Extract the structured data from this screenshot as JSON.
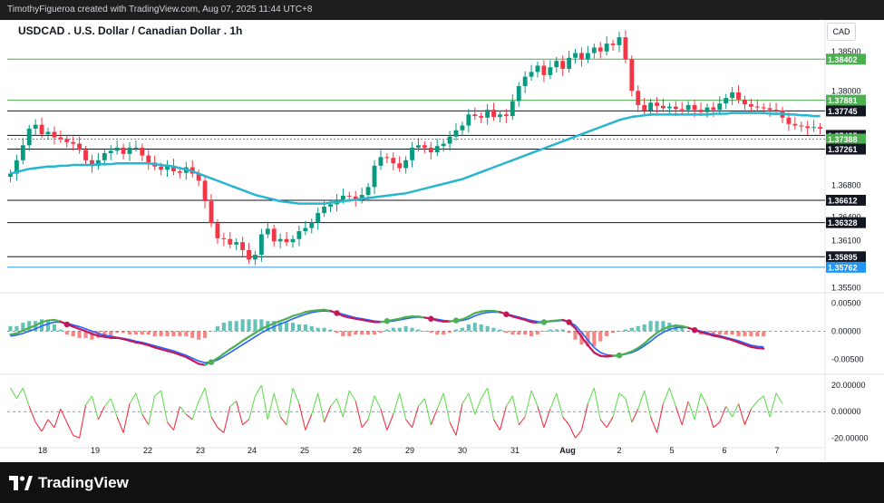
{
  "header": {
    "attribution": "TimothyFigueroa created with TradingView.com, Aug 07, 2025 11:44 UTC+8",
    "title": "USDCAD . U.S. Dollar / Canadian Dollar . 1h",
    "currency": "CAD"
  },
  "footer": {
    "brand": "TradingView"
  },
  "colors": {
    "bull": "#089981",
    "bear": "#f23645",
    "ma": "#27b6d0",
    "macd_fast_up": "#4caf50",
    "macd_fast_down": "#c2185b",
    "macd_slow": "#2962ff",
    "rsi_up": "#66dd55",
    "rsi_down": "#ee3344",
    "level": "#131722",
    "level_green": "#4caf50",
    "level_blue": "#2196f3"
  },
  "chart_data": [
    {
      "type": "candlestick",
      "name": "price",
      "x": [
        "18",
        "19",
        "22",
        "23",
        "24",
        "25",
        "26",
        "29",
        "30",
        "31",
        "Aug",
        "2",
        "5",
        "6",
        "7"
      ],
      "ylim": [
        1.3545,
        1.389
      ],
      "y_ticks": [
        "1.38500",
        "1.38000",
        "1.36800",
        "1.36400",
        "1.36100",
        "1.35500"
      ],
      "ma_name": "",
      "closes": [
        1.3695,
        1.3712,
        1.3731,
        1.3752,
        1.3757,
        1.3745,
        1.3748,
        1.3741,
        1.3739,
        1.3735,
        1.3733,
        1.3725,
        1.3712,
        1.3705,
        1.3712,
        1.3721,
        1.3724,
        1.3728,
        1.372,
        1.3728,
        1.3728,
        1.3718,
        1.3709,
        1.3704,
        1.37,
        1.3705,
        1.3698,
        1.3696,
        1.3703,
        1.3695,
        1.3686,
        1.366,
        1.3632,
        1.3613,
        1.3612,
        1.3605,
        1.3608,
        1.3598,
        1.3586,
        1.3592,
        1.3618,
        1.3625,
        1.3609,
        1.3612,
        1.3608,
        1.3612,
        1.3622,
        1.3626,
        1.3633,
        1.3645,
        1.3653,
        1.3656,
        1.3662,
        1.3667,
        1.3666,
        1.3662,
        1.3668,
        1.3678,
        1.3705,
        1.3716,
        1.3715,
        1.3708,
        1.3702,
        1.3712,
        1.3728,
        1.3731,
        1.3728,
        1.3722,
        1.373,
        1.3733,
        1.3742,
        1.375,
        1.3756,
        1.377,
        1.3768,
        1.3766,
        1.3776,
        1.3767,
        1.377,
        1.3768,
        1.3787,
        1.3806,
        1.3818,
        1.3824,
        1.3832,
        1.382,
        1.383,
        1.3838,
        1.3828,
        1.3842,
        1.3848,
        1.384,
        1.3848,
        1.3855,
        1.385,
        1.386,
        1.3858,
        1.3868,
        1.384,
        1.38,
        1.3782,
        1.3775,
        1.3785,
        1.3781,
        1.3778,
        1.378,
        1.3777,
        1.3776,
        1.3782,
        1.3776,
        1.3773,
        1.3779,
        1.3776,
        1.3784,
        1.3791,
        1.3798,
        1.3789,
        1.3783,
        1.378,
        1.3779,
        1.3778,
        1.3776,
        1.3775,
        1.3766,
        1.3758,
        1.3756,
        1.3755,
        1.3753,
        1.3754,
        1.3752
      ],
      "ma": [
        1.3695,
        1.3697,
        1.3699,
        1.3701,
        1.3702,
        1.3703,
        1.3704,
        1.3704,
        1.3705,
        1.3705,
        1.3706,
        1.3706,
        1.3706,
        1.3706,
        1.3707,
        1.3707,
        1.3707,
        1.3708,
        1.3708,
        1.3708,
        1.3708,
        1.3708,
        1.3708,
        1.3707,
        1.3706,
        1.3705,
        1.3704,
        1.3702,
        1.37,
        1.3698,
        1.3695,
        1.3692,
        1.3689,
        1.3686,
        1.3683,
        1.368,
        1.3677,
        1.3674,
        1.3671,
        1.3668,
        1.3666,
        1.3664,
        1.3662,
        1.366,
        1.3659,
        1.3658,
        1.3657,
        1.3657,
        1.3657,
        1.3657,
        1.3657,
        1.3658,
        1.3659,
        1.366,
        1.3661,
        1.3662,
        1.3663,
        1.3664,
        1.3665,
        1.3666,
        1.3667,
        1.3668,
        1.3669,
        1.367,
        1.3672,
        1.3674,
        1.3676,
        1.3678,
        1.368,
        1.3682,
        1.3684,
        1.3686,
        1.3688,
        1.3691,
        1.3694,
        1.3697,
        1.37,
        1.3703,
        1.3706,
        1.3709,
        1.3712,
        1.3715,
        1.3718,
        1.3721,
        1.3724,
        1.3727,
        1.373,
        1.3733,
        1.3736,
        1.3739,
        1.3742,
        1.3745,
        1.3748,
        1.3751,
        1.3754,
        1.3757,
        1.376,
        1.3763,
        1.3765,
        1.3767,
        1.3768,
        1.3769,
        1.377,
        1.377,
        1.377,
        1.377,
        1.377,
        1.377,
        1.377,
        1.377,
        1.377,
        1.377,
        1.3771,
        1.3771,
        1.3771,
        1.3772,
        1.3772,
        1.3772,
        1.3772,
        1.3772,
        1.3772,
        1.3771,
        1.3771,
        1.3771,
        1.377,
        1.377,
        1.3769,
        1.3769,
        1.3768,
        1.3768
      ],
      "levels": [
        {
          "value": 1.38402,
          "label": "1.38402",
          "style": "green"
        },
        {
          "value": 1.37881,
          "label": "1.37881",
          "style": "green"
        },
        {
          "value": 1.37745,
          "label": "1.37745",
          "style": "dark"
        },
        {
          "value": 1.37435,
          "label": "1.37435",
          "style": "dark"
        },
        {
          "value": 1.37388,
          "label": "1.37388",
          "style": "green"
        },
        {
          "value": 1.37261,
          "label": "1.37261",
          "style": "dark"
        },
        {
          "value": 1.36612,
          "label": "1.36612",
          "style": "dark"
        },
        {
          "value": 1.36328,
          "label": "1.36328",
          "style": "dark"
        },
        {
          "value": 1.35895,
          "label": "1.35895",
          "style": "dark"
        },
        {
          "value": 1.35762,
          "label": "1.35762",
          "style": "blue"
        }
      ]
    },
    {
      "type": "line",
      "name": "macd",
      "ylim": [
        -0.0075,
        0.0065
      ],
      "y_ticks": [
        "0.00500",
        "0.00000",
        "-0.00500"
      ],
      "fast": [
        -0.0006,
        -0.0004,
        0.0001,
        0.0006,
        0.001,
        0.0016,
        0.0019,
        0.002,
        0.0017,
        0.0012,
        0.0008,
        0.0004,
        0.0,
        -0.0005,
        -0.0008,
        -0.001,
        -0.0012,
        -0.0012,
        -0.0014,
        -0.0017,
        -0.002,
        -0.0022,
        -0.0025,
        -0.0029,
        -0.0032,
        -0.0035,
        -0.0038,
        -0.0042,
        -0.0046,
        -0.0052,
        -0.0058,
        -0.006,
        -0.0055,
        -0.0048,
        -0.004,
        -0.0032,
        -0.0025,
        -0.0017,
        -0.001,
        -0.0003,
        0.0004,
        0.0009,
        0.0014,
        0.0018,
        0.0022,
        0.0027,
        0.003,
        0.0034,
        0.0036,
        0.0037,
        0.0038,
        0.0036,
        0.0032,
        0.0027,
        0.0024,
        0.0022,
        0.002,
        0.0018,
        0.0016,
        0.0016,
        0.0018,
        0.002,
        0.0022,
        0.0025,
        0.0026,
        0.0026,
        0.0024,
        0.0022,
        0.0019,
        0.0017,
        0.0017,
        0.0019,
        0.0021,
        0.0026,
        0.0032,
        0.0035,
        0.0036,
        0.0036,
        0.0034,
        0.003,
        0.0026,
        0.0023,
        0.002,
        0.0016,
        0.0015,
        0.0016,
        0.0018,
        0.0019,
        0.002,
        0.0016,
        0.0005,
        -0.001,
        -0.0025,
        -0.0038,
        -0.0044,
        -0.0045,
        -0.0044,
        -0.0043,
        -0.004,
        -0.0036,
        -0.003,
        -0.0022,
        -0.0012,
        -0.0003,
        0.0004,
        0.0008,
        0.001,
        0.0009,
        0.0006,
        0.0002,
        -0.0002,
        -0.0005,
        -0.0008,
        -0.001,
        -0.0013,
        -0.0016,
        -0.002,
        -0.0024,
        -0.0028,
        -0.003,
        -0.0031
      ],
      "slow": [
        -0.0009,
        -0.0007,
        -0.0004,
        0.0,
        0.0004,
        0.0009,
        0.0013,
        0.0016,
        0.0016,
        0.0014,
        0.0011,
        0.0008,
        0.0004,
        0.0,
        -0.0004,
        -0.0007,
        -0.0009,
        -0.0011,
        -0.0013,
        -0.0015,
        -0.0018,
        -0.002,
        -0.0023,
        -0.0026,
        -0.0029,
        -0.0032,
        -0.0035,
        -0.0039,
        -0.0043,
        -0.0048,
        -0.0053,
        -0.0056,
        -0.0055,
        -0.0051,
        -0.0045,
        -0.0038,
        -0.0031,
        -0.0024,
        -0.0017,
        -0.001,
        -0.0003,
        0.0003,
        0.0008,
        0.0013,
        0.0017,
        0.0022,
        0.0026,
        0.003,
        0.0033,
        0.0035,
        0.0036,
        0.0035,
        0.0033,
        0.003,
        0.0027,
        0.0024,
        0.0022,
        0.002,
        0.0018,
        0.0017,
        0.0017,
        0.0018,
        0.002,
        0.0022,
        0.0024,
        0.0025,
        0.0024,
        0.0023,
        0.0021,
        0.0019,
        0.0018,
        0.0018,
        0.0019,
        0.0022,
        0.0027,
        0.0031,
        0.0033,
        0.0034,
        0.0033,
        0.0031,
        0.0028,
        0.0025,
        0.0022,
        0.0019,
        0.0017,
        0.0016,
        0.0017,
        0.0018,
        0.0019,
        0.0017,
        0.001,
        -0.0002,
        -0.0016,
        -0.0029,
        -0.0038,
        -0.0042,
        -0.0043,
        -0.0043,
        -0.0041,
        -0.0038,
        -0.0033,
        -0.0026,
        -0.0018,
        -0.0009,
        -0.0002,
        0.0003,
        0.0006,
        0.0007,
        0.0006,
        0.0003,
        0.0,
        -0.0003,
        -0.0006,
        -0.0008,
        -0.0011,
        -0.0014,
        -0.0017,
        -0.0021,
        -0.0025,
        -0.0027,
        -0.0028
      ]
    },
    {
      "type": "line",
      "name": "momentum",
      "ylim": [
        -26,
        27
      ],
      "y_ticks": [
        "20.00000",
        "0.00000",
        "-20.00000"
      ],
      "values": [
        18,
        10,
        18,
        4,
        -8,
        -15,
        -6,
        -12,
        2,
        -8,
        -18,
        -20,
        5,
        12,
        -6,
        4,
        10,
        -4,
        -16,
        6,
        14,
        -2,
        -10,
        12,
        16,
        -8,
        -14,
        4,
        -2,
        -6,
        8,
        18,
        -4,
        -12,
        -16,
        4,
        8,
        -10,
        -6,
        12,
        20,
        -6,
        14,
        -4,
        -10,
        18,
        6,
        -14,
        -2,
        14,
        -8,
        4,
        10,
        -4,
        16,
        8,
        -12,
        -6,
        12,
        2,
        -14,
        -2,
        14,
        -6,
        -12,
        4,
        10,
        -10,
        2,
        14,
        -8,
        -18,
        6,
        14,
        -2,
        10,
        18,
        -6,
        -14,
        4,
        12,
        -10,
        -4,
        16,
        4,
        -12,
        2,
        14,
        -4,
        -10,
        -20,
        -14,
        6,
        18,
        -6,
        -12,
        -4,
        14,
        10,
        -8,
        2,
        16,
        -4,
        -16,
        6,
        18,
        4,
        -10,
        8,
        -6,
        14,
        4,
        -12,
        -8,
        4,
        -4,
        6,
        -10,
        2,
        8,
        12,
        -4,
        14,
        6
      ]
    }
  ]
}
